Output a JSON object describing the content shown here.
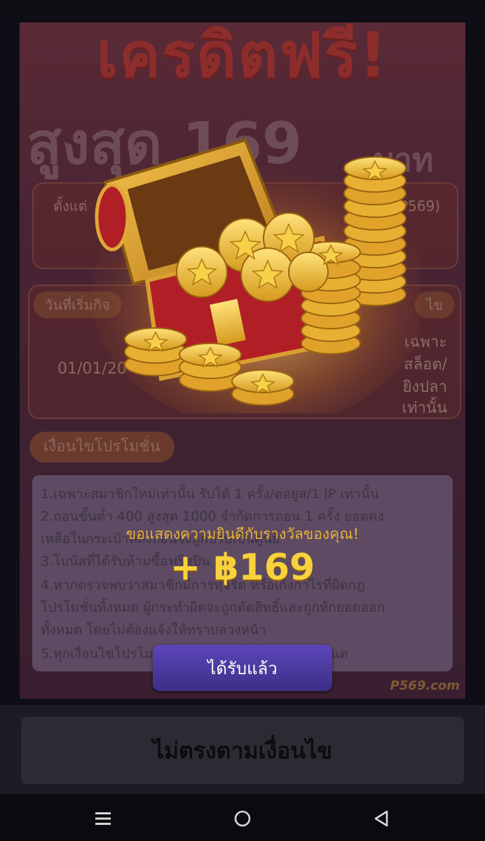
{
  "banner": {
    "title": "เครดิตฟรี!",
    "subtitle": "สูงสุด 169",
    "unit": "บาท",
    "start_label": "ตั้งแต่",
    "web_label": "ต (P569)",
    "date_tag": "วันที่เริ่มกิจ",
    "right_tag": "ไข",
    "date_value": "01/01/20",
    "game_note_1": "เฉพาะ",
    "game_note_2": "สล็อต/",
    "game_note_3": "ยิงปลา",
    "game_note_4": "เท่านั้น",
    "rules_heading": "เงื่อนไขโปรโมชั่น",
    "rules": [
      "1.เฉพาะสมาชิกใหม่เท่านั้น รับได้ 1 ครั้ง/ต่อยูส/1 IP เท่านั้น",
      "2.ถอนขั้นต่ำ 400 สูงสุด 1000 จำกัดการถอน 1 ครั้ง ยอดคง",
      "  เหลือในกระเป๋าหลังถอนจะถูกปรับเป็นศูนย์",
      "3.โบนัสที่ได้รับห้ามซื้อฟรีสปิน",
      "4.หากตรวจพบว่าสมาชิกมีการทุจริต หรือเก็งกำไรที่ผิดกฎ",
      "  โปรโมชั่นทั้งหมด ผู้กระทำผิดจะถูกตัดสิทธิ์และถูกหักยอดออก",
      "  ทั้งหมด โดยไม่ต้องแจ้งให้ทราบล่วงหน้า",
      "5.ทุกเงื่อนไขโปรโมชั่นเป็นไปตามเว็บ (P569) กำหนด"
    ],
    "logo": "P569.com"
  },
  "reward": {
    "congrats": "ขอแสดงความยินดีกับรางวัลของคุณ!",
    "amount": "+ ฿169",
    "claim_label": "ได้รับแล้ว"
  },
  "footer": {
    "condition_label": "ไม่ตรงตามเงื่อนไข"
  },
  "navbar": {
    "icons": [
      "menu-icon",
      "home-icon",
      "back-icon"
    ]
  },
  "colors": {
    "gold": "#f7d23c",
    "claim_button": "#4a38a0"
  }
}
